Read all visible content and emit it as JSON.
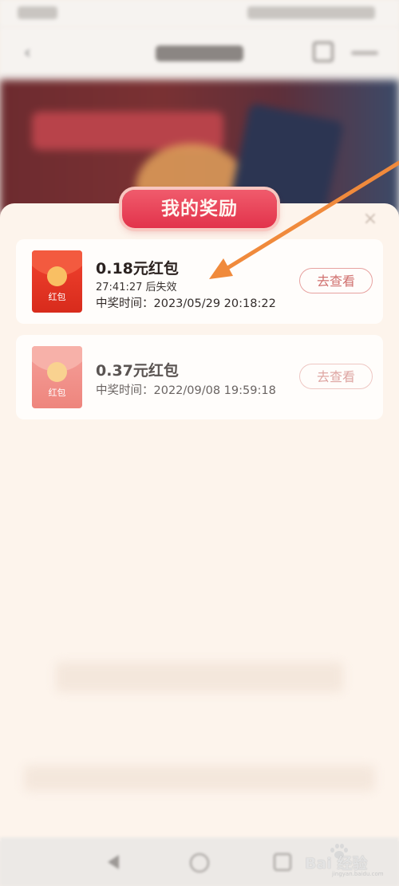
{
  "panel": {
    "title": "我的奖励",
    "close_icon": "close-icon"
  },
  "rewards": [
    {
      "title": "0.18元红包",
      "expiry": "27:41:27 后失效",
      "win_time": "中奖时间：2023/05/29 20:18:22",
      "envelope_label": "红包",
      "button": "去查看"
    },
    {
      "title": "0.37元红包",
      "win_time": "中奖时间：2022/09/08 19:59:18",
      "envelope_label": "红包",
      "button": "去查看"
    }
  ],
  "annotation": {
    "color": "#f08a3c",
    "target": "reward-card-1-title"
  },
  "watermark": {
    "text": "Bai 经验",
    "sub": "jingyan.baidu.com"
  },
  "colors": {
    "accent": "#e2334b",
    "envelope": "#e93a28",
    "panel_bg": "#fdf4ec"
  }
}
